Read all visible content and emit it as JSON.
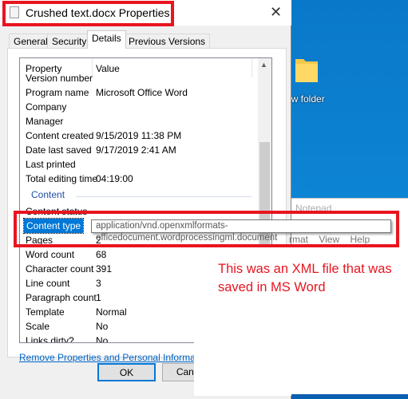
{
  "desktop": {
    "folder_label": "ew folder",
    "folder_color": "#f2c94c"
  },
  "notepad": {
    "title": "Notepad",
    "menu": [
      "rmat",
      "View",
      "Help"
    ]
  },
  "dialog": {
    "title": "Crushed text.docx Properties",
    "close_icon": "close-icon",
    "tabs": [
      {
        "label": "General"
      },
      {
        "label": "Security"
      },
      {
        "label": "Details",
        "selected": true
      },
      {
        "label": "Previous Versions"
      }
    ],
    "columns": {
      "property": "Property",
      "value": "Value"
    },
    "rows_top": [
      {
        "p": "Version number",
        "v": ""
      },
      {
        "p": "Program name",
        "v": "Microsoft Office Word"
      },
      {
        "p": "Company",
        "v": ""
      },
      {
        "p": "Manager",
        "v": ""
      },
      {
        "p": "Content created",
        "v": "9/15/2019 11:38 PM"
      },
      {
        "p": "Date last saved",
        "v": "9/17/2019 2:41 AM"
      },
      {
        "p": "Last printed",
        "v": ""
      },
      {
        "p": "Total editing time",
        "v": "04:19:00"
      }
    ],
    "section": "Content",
    "rows_bottom": [
      {
        "p": "Content status",
        "v": ""
      },
      {
        "p": "Content type",
        "v": ""
      },
      {
        "p": "Pages",
        "v": "2"
      },
      {
        "p": "Word count",
        "v": "68"
      },
      {
        "p": "Character count",
        "v": "391"
      },
      {
        "p": "Line count",
        "v": "3"
      },
      {
        "p": "Paragraph count",
        "v": "1"
      },
      {
        "p": "Template",
        "v": "Normal"
      },
      {
        "p": "Scale",
        "v": "No"
      },
      {
        "p": "Links dirty?",
        "v": "No"
      }
    ],
    "tooltip": "application/vnd.openxmlformats-officedocument.wordprocessingml.document",
    "remove_link": "Remove Properties and Personal Information",
    "ok": "OK",
    "cancel": "Cancel"
  },
  "annotation": {
    "text": "This was an XML file that was saved in MS Word",
    "color": "#e8151f"
  }
}
